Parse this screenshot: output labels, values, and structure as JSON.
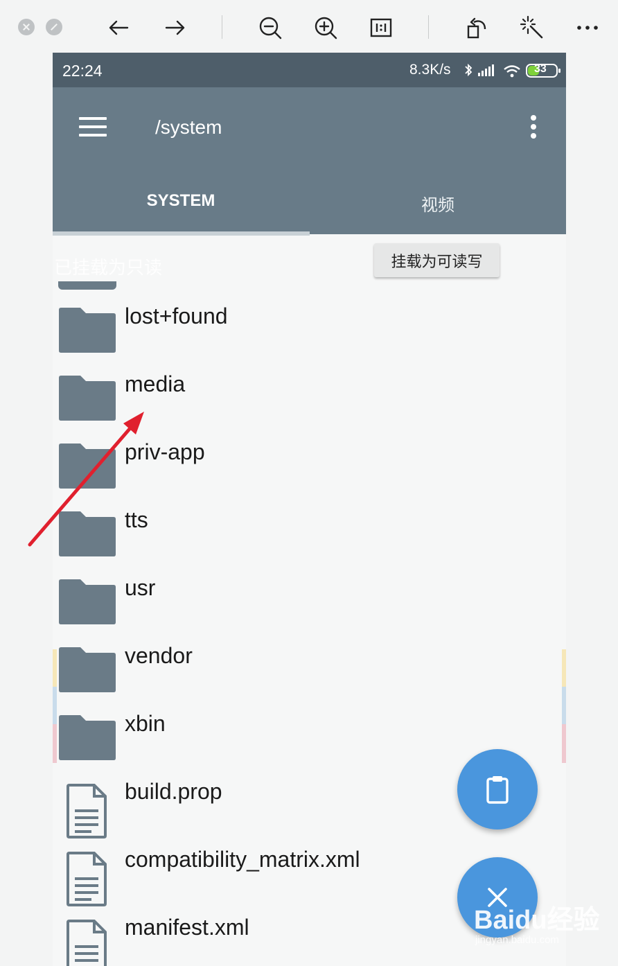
{
  "status_bar": {
    "time": "22:24",
    "net_speed": "8.3K/s",
    "battery": "33"
  },
  "app_bar": {
    "title": "/system",
    "tabs": [
      {
        "label": "SYSTEM"
      },
      {
        "label": "视频"
      }
    ]
  },
  "banner": {
    "text": "已挂载为只读",
    "mount_button": "挂载为可读写"
  },
  "files": [
    {
      "name": "lost+found",
      "type": "folder"
    },
    {
      "name": "media",
      "type": "folder"
    },
    {
      "name": "priv-app",
      "type": "folder"
    },
    {
      "name": "tts",
      "type": "folder"
    },
    {
      "name": "usr",
      "type": "folder"
    },
    {
      "name": "vendor",
      "type": "folder"
    },
    {
      "name": "xbin",
      "type": "folder"
    },
    {
      "name": "build.prop",
      "type": "file"
    },
    {
      "name": "compatibility_matrix.xml",
      "type": "file"
    },
    {
      "name": "manifest.xml",
      "type": "file"
    }
  ],
  "watermark": {
    "logo": "Baidu经验",
    "url": "jingyan.baidu.com"
  },
  "colors": {
    "status_bar": "#4e5e6a",
    "app_bar": "#687b88",
    "folder": "#6a7b87",
    "fab": "#4a96dd",
    "annotation_arrow": "#e0202e"
  }
}
